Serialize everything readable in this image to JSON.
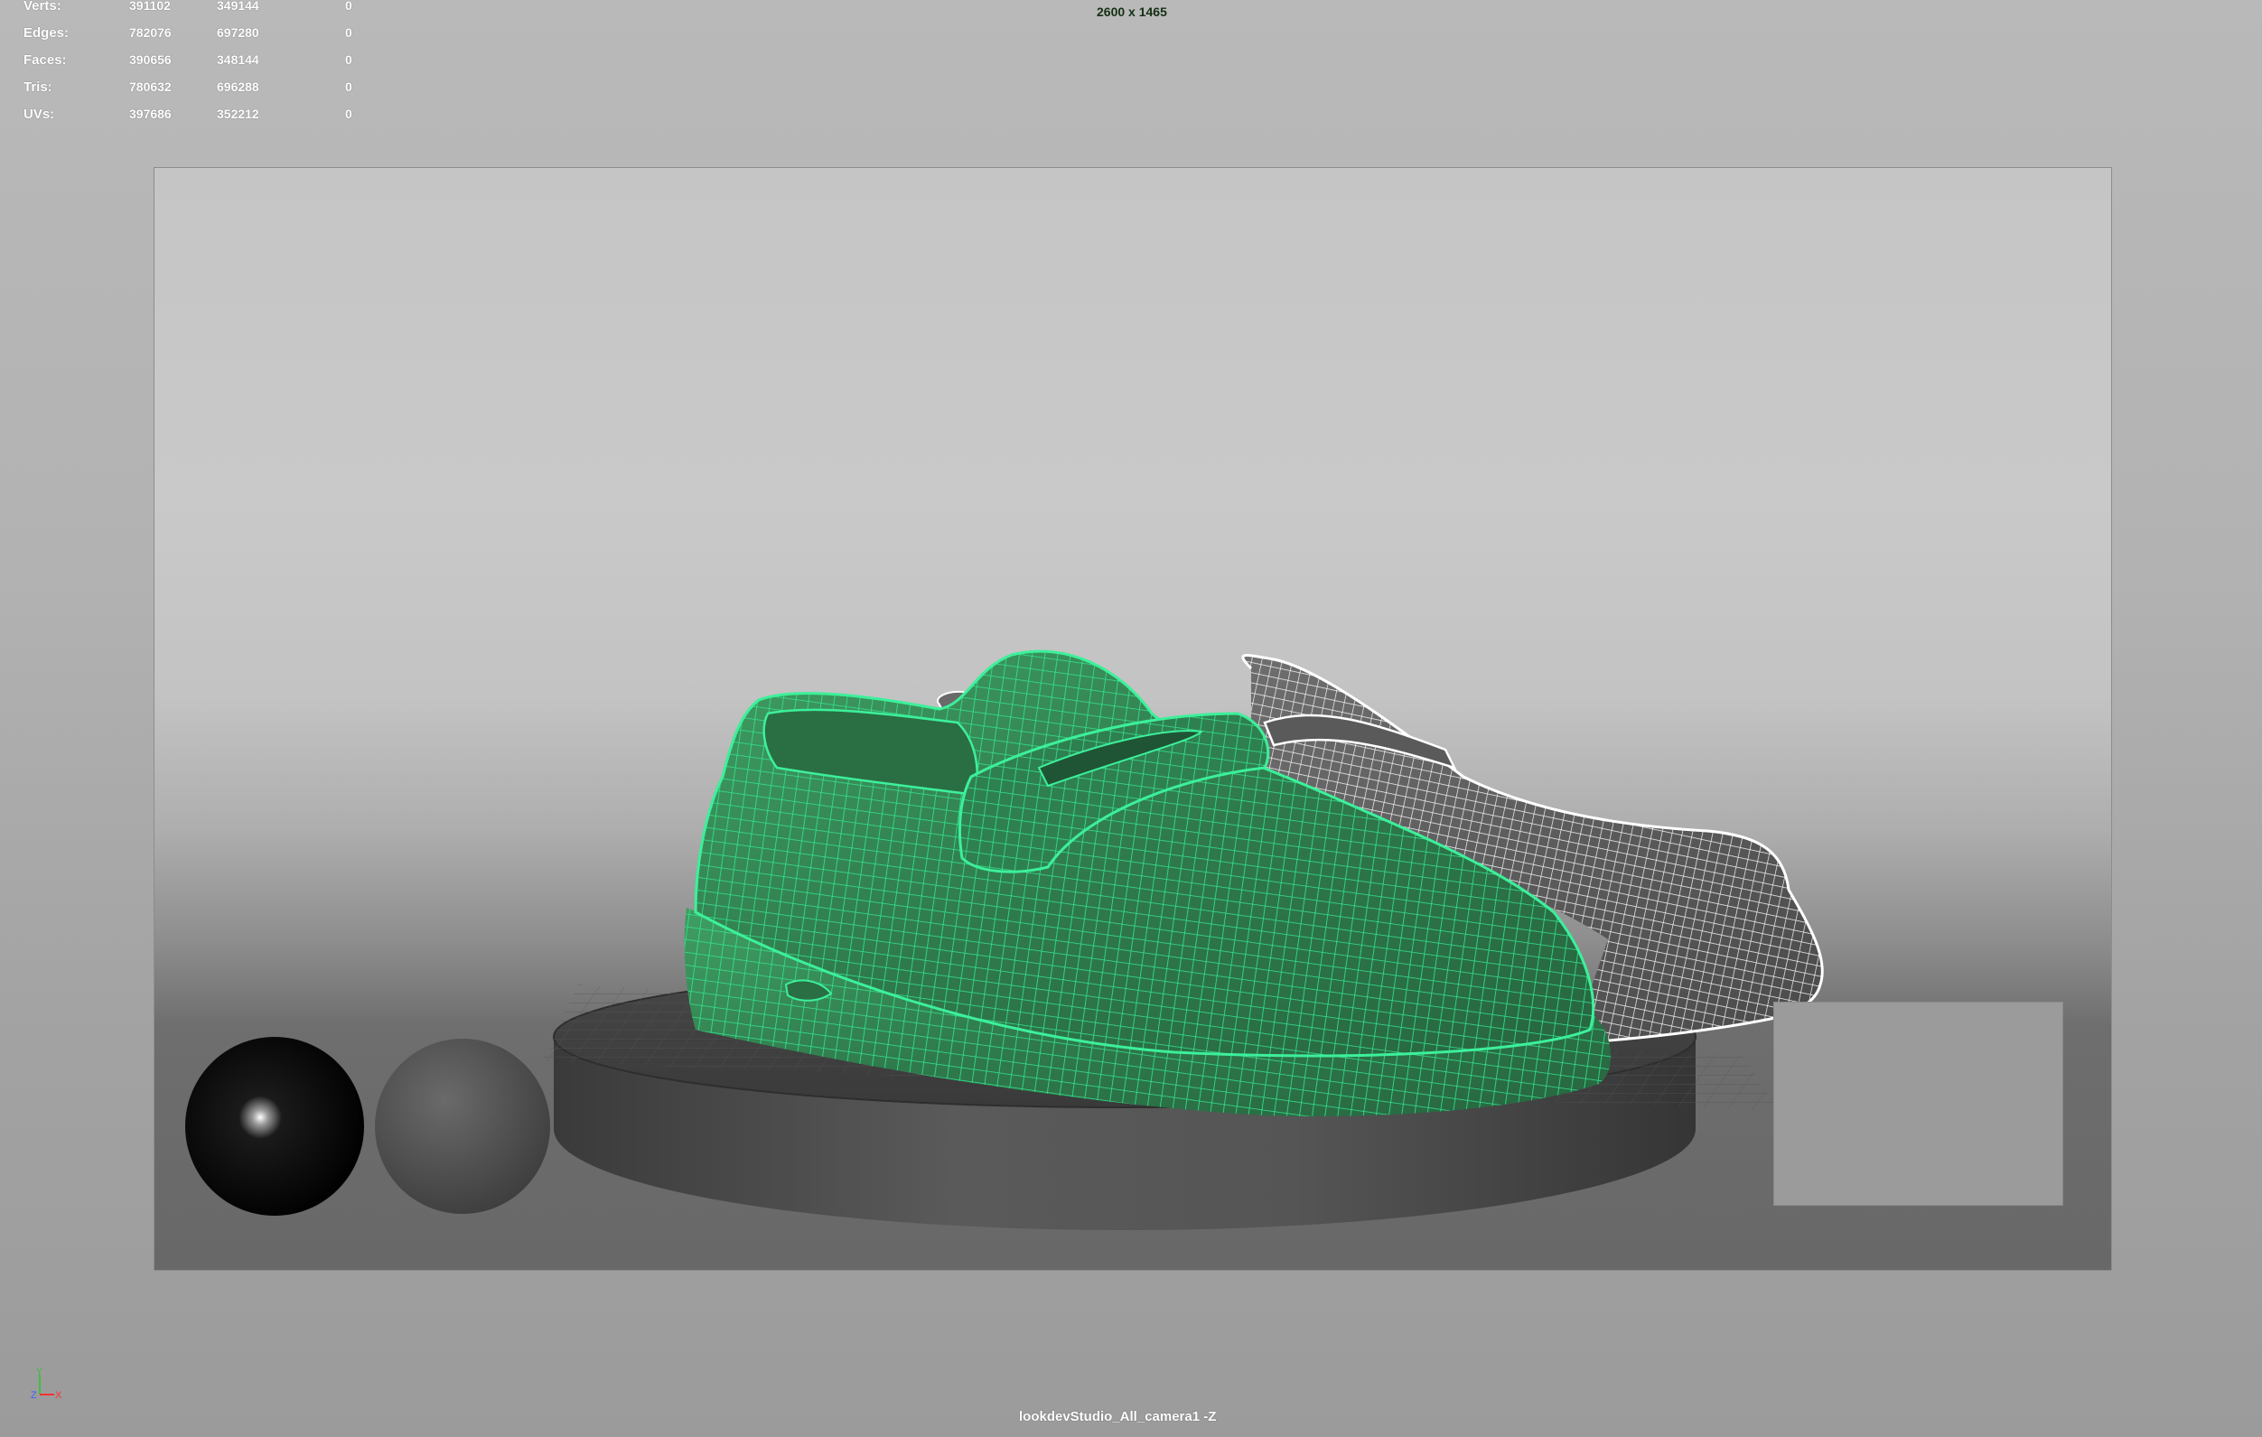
{
  "hud": {
    "rows": [
      {
        "label": "Verts:",
        "v1": "391102",
        "v2": "349144",
        "v3": "0"
      },
      {
        "label": "Edges:",
        "v1": "782076",
        "v2": "697280",
        "v3": "0"
      },
      {
        "label": "Faces:",
        "v1": "390656",
        "v2": "348144",
        "v3": "0"
      },
      {
        "label": "Tris:",
        "v1": "780632",
        "v2": "696288",
        "v3": "0"
      },
      {
        "label": "UVs:",
        "v1": "397686",
        "v2": "352212",
        "v3": "0"
      }
    ]
  },
  "viewport": {
    "resolution": "2600 x 1465",
    "camera_label": "lookdevStudio_All_camera1 -Z"
  },
  "axis_gizmo": {
    "y": "Y",
    "z": "Z",
    "x": "X"
  },
  "colors": {
    "selection_wire": "#2ee08a",
    "shoe_fill": "#3a8f5c",
    "unselected_wire": "#ffffff",
    "axis_y": "#3fbf3f",
    "axis_z": "#4060ff",
    "axis_x": "#ff3030"
  },
  "icons": {
    "axis": "xyz-axis-gizmo-icon"
  }
}
